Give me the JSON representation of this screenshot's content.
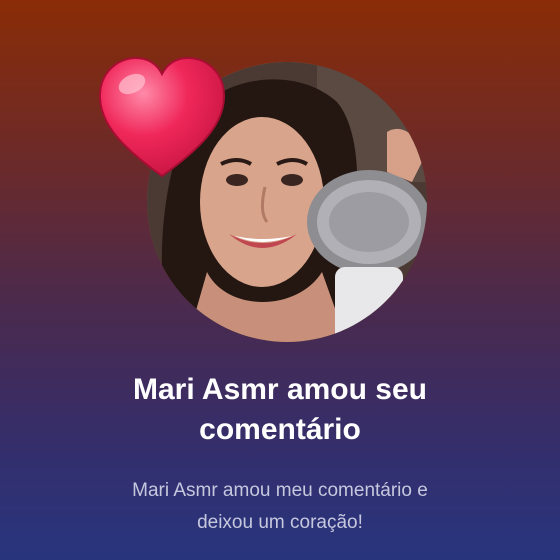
{
  "notification": {
    "title_line1": "Mari Asmr amou seu",
    "title_line2": "comentário",
    "message_line1": "Mari Asmr amou meu comentário e",
    "message_line2": "deixou um coração!"
  },
  "icons": {
    "heart": "heart-icon"
  },
  "colors": {
    "gradient_top": "#8a2c07",
    "gradient_bottom": "#28357e",
    "heart": "#f0285a",
    "title": "#ffffff",
    "message": "#c6c8de"
  }
}
